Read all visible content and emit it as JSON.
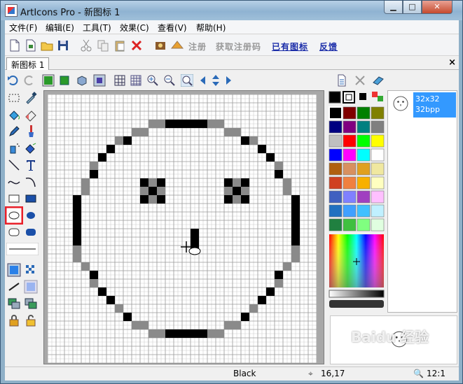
{
  "window": {
    "title": "ArtIcons Pro - 新图标 1",
    "min_glyph": "▁",
    "max_glyph": "□",
    "close_glyph": "✕"
  },
  "menu": [
    "文件(F)",
    "编辑(E)",
    "工具(T)",
    "效果(C)",
    "查看(V)",
    "帮助(H)"
  ],
  "toolbar": {
    "register": "注册",
    "get_code": "获取注册码",
    "have_icons": "已有图标",
    "feedback": "反馈"
  },
  "tab": {
    "label": "新图标 1",
    "close_glyph": "×"
  },
  "format": {
    "size": "32x32",
    "depth": "32bpp"
  },
  "status": {
    "color_name": "Black",
    "coords": "16,17",
    "zoom": "12:1"
  },
  "watermark": "Baidu 经验",
  "colors": {
    "accent": "#3399ff",
    "selected_tool_highlight": "#e8202a",
    "palette": [
      "#000000",
      "#800000",
      "#008000",
      "#808000",
      "#000080",
      "#800080",
      "#008080",
      "#808080",
      "#c0c0c0",
      "#ff0000",
      "#00ff00",
      "#ffff00",
      "#0000ff",
      "#ff00ff",
      "#00ffff",
      "#ffffff",
      "#b06010",
      "#d89060",
      "#e0a020",
      "#f0e8a0",
      "#d04020",
      "#f08040",
      "#f8b000",
      "#ffffc0",
      "#4060c0",
      "#8080ff",
      "#a040c0",
      "#ffc0ff",
      "#2070c0",
      "#40a0ff",
      "#40c0ff",
      "#c0f0ff",
      "#208040",
      "#40c040",
      "#80ff80",
      "#e0ffe0"
    ]
  },
  "icon_pixels": {
    "size": 32,
    "dark": [
      [
        14,
        3
      ],
      [
        15,
        3
      ],
      [
        16,
        3
      ],
      [
        17,
        3
      ],
      [
        18,
        3
      ],
      [
        9,
        5
      ],
      [
        23,
        5
      ],
      [
        7,
        6
      ],
      [
        25,
        6
      ],
      [
        6,
        7
      ],
      [
        26,
        7
      ],
      [
        5,
        9
      ],
      [
        27,
        9
      ],
      [
        11,
        10
      ],
      [
        13,
        10
      ],
      [
        21,
        10
      ],
      [
        23,
        10
      ],
      [
        12,
        11
      ],
      [
        22,
        11
      ],
      [
        11,
        12
      ],
      [
        13,
        12
      ],
      [
        21,
        12
      ],
      [
        23,
        12
      ],
      [
        3,
        12
      ],
      [
        29,
        12
      ],
      [
        3,
        13
      ],
      [
        29,
        13
      ],
      [
        3,
        14
      ],
      [
        29,
        14
      ],
      [
        3,
        15
      ],
      [
        29,
        15
      ],
      [
        3,
        16
      ],
      [
        29,
        16
      ],
      [
        3,
        17
      ],
      [
        29,
        17
      ],
      [
        17,
        16
      ],
      [
        17,
        17
      ],
      [
        17,
        18
      ],
      [
        5,
        21
      ],
      [
        27,
        21
      ],
      [
        6,
        23
      ],
      [
        26,
        23
      ],
      [
        7,
        24
      ],
      [
        25,
        24
      ],
      [
        9,
        26
      ],
      [
        23,
        26
      ],
      [
        14,
        28
      ],
      [
        15,
        28
      ],
      [
        16,
        28
      ],
      [
        17,
        28
      ],
      [
        18,
        28
      ]
    ],
    "mid": [
      [
        12,
        3
      ],
      [
        13,
        3
      ],
      [
        19,
        3
      ],
      [
        20,
        3
      ],
      [
        10,
        4
      ],
      [
        11,
        4
      ],
      [
        21,
        4
      ],
      [
        22,
        4
      ],
      [
        8,
        5
      ],
      [
        24,
        5
      ],
      [
        5,
        8
      ],
      [
        27,
        8
      ],
      [
        4,
        10
      ],
      [
        28,
        10
      ],
      [
        4,
        11
      ],
      [
        28,
        11
      ],
      [
        11,
        11
      ],
      [
        13,
        11
      ],
      [
        12,
        10
      ],
      [
        12,
        12
      ],
      [
        21,
        11
      ],
      [
        23,
        11
      ],
      [
        22,
        10
      ],
      [
        22,
        12
      ],
      [
        3,
        18
      ],
      [
        29,
        18
      ],
      [
        3,
        19
      ],
      [
        29,
        19
      ],
      [
        4,
        20
      ],
      [
        28,
        20
      ],
      [
        5,
        22
      ],
      [
        27,
        22
      ],
      [
        8,
        25
      ],
      [
        24,
        25
      ],
      [
        10,
        27
      ],
      [
        11,
        27
      ],
      [
        21,
        27
      ],
      [
        22,
        27
      ],
      [
        12,
        28
      ],
      [
        13,
        28
      ],
      [
        19,
        28
      ],
      [
        20,
        28
      ]
    ]
  }
}
